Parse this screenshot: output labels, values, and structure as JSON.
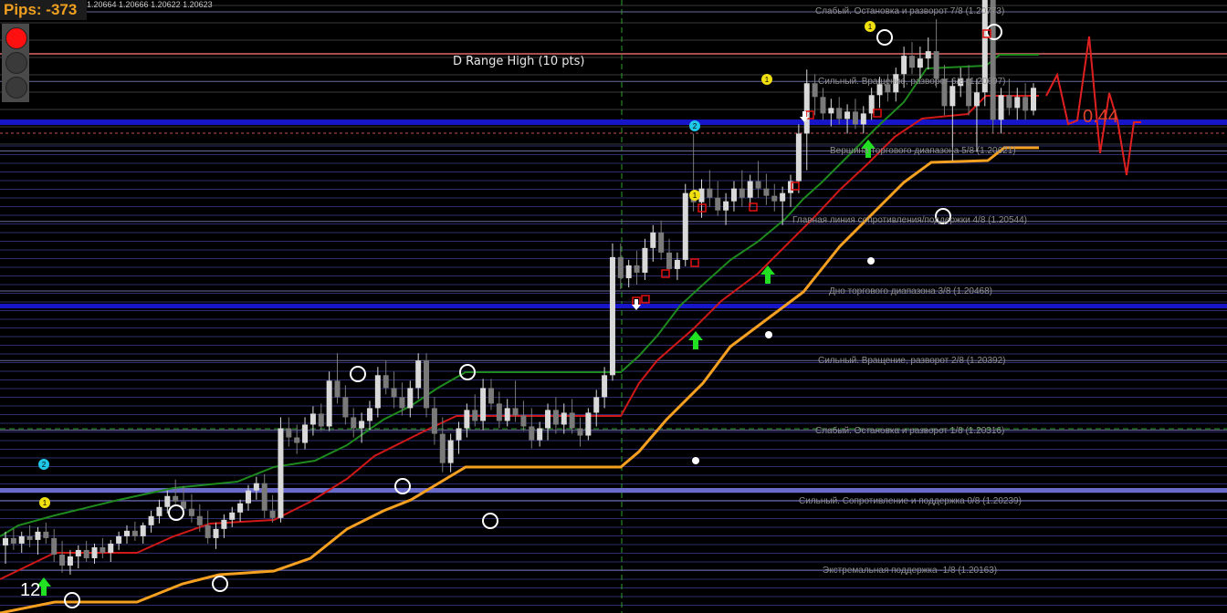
{
  "header": {
    "pips_text": "Pips:  -373",
    "ohlc_text": "1.20664 1.20666 1.20622 1.20623"
  },
  "traffic_light": {
    "active": "red",
    "colors": [
      "red",
      "off",
      "off"
    ]
  },
  "overlay": {
    "d_range_label": "D Range High (10 pts)",
    "ratio_value": "0.44",
    "bar_count": "12"
  },
  "levels": [
    {
      "label": "Слабый. Остановка и разворот 7/8  (1.20773)",
      "price": 1.20773
    },
    {
      "label": "Сильный. Вращение, разворот 6/8  (1.20697)",
      "price": 1.20697
    },
    {
      "label": "Вершина торгового диапазона 5/8  (1.20621)",
      "price": 1.20621
    },
    {
      "label": "Главная линия сопротивления/поддержки 4/8  (1.20544)",
      "price": 1.20544
    },
    {
      "label": "Дно торгового диапазона 3/8  (1.20468)",
      "price": 1.20468
    },
    {
      "label": "Сильный. Вращение, разворот 2/8  (1.20392)",
      "price": 1.20392
    },
    {
      "label": "Слабый. Остановка и разворот 1/8  (1.20316)",
      "price": 1.20316
    },
    {
      "label": "Сильный. Сопротивление и поддержка 0/8  (1.20239)",
      "price": 1.20239
    },
    {
      "label": "Экстремальная поддержка -1/8  (1.20163)",
      "price": 1.20163
    }
  ],
  "markers": {
    "yellow": "1",
    "cyan": "2"
  },
  "colors": {
    "background": "#000000",
    "candle_bull": "#d9d9d9",
    "candle_bear": "#7a7a7a",
    "line_green": "#1e8a1e",
    "line_red": "#d01818",
    "line_orange": "#f5a020",
    "level_blue": "#1616c8",
    "level_violet": "#6a6ac8",
    "arrow_green": "#22e022",
    "box_red": "#e01010",
    "d_range_line": "#e06868"
  },
  "chart_data": {
    "type": "candlestick",
    "title": "",
    "y_range": [
      1.2015,
      1.2085
    ],
    "levels": [
      1.20773,
      1.20697,
      1.20621,
      1.20544,
      1.20468,
      1.20392,
      1.20316,
      1.20239,
      1.20163
    ],
    "candles": [
      {
        "o": 1.2019,
        "h": 1.20205,
        "l": 1.2017,
        "c": 1.20198
      },
      {
        "o": 1.20198,
        "h": 1.20208,
        "l": 1.20185,
        "c": 1.20192
      },
      {
        "o": 1.20192,
        "h": 1.20205,
        "l": 1.20182,
        "c": 1.202
      },
      {
        "o": 1.202,
        "h": 1.20212,
        "l": 1.20188,
        "c": 1.20196
      },
      {
        "o": 1.20196,
        "h": 1.2021,
        "l": 1.2018,
        "c": 1.20205
      },
      {
        "o": 1.20205,
        "h": 1.20215,
        "l": 1.20192,
        "c": 1.20198
      },
      {
        "o": 1.20198,
        "h": 1.20208,
        "l": 1.20172,
        "c": 1.2018
      },
      {
        "o": 1.2018,
        "h": 1.20195,
        "l": 1.2016,
        "c": 1.20168
      },
      {
        "o": 1.20168,
        "h": 1.20185,
        "l": 1.20158,
        "c": 1.20178
      },
      {
        "o": 1.20178,
        "h": 1.2019,
        "l": 1.20165,
        "c": 1.20185
      },
      {
        "o": 1.20185,
        "h": 1.20195,
        "l": 1.20172,
        "c": 1.20176
      },
      {
        "o": 1.20176,
        "h": 1.20192,
        "l": 1.2017,
        "c": 1.20188
      },
      {
        "o": 1.20188,
        "h": 1.20198,
        "l": 1.20176,
        "c": 1.20182
      },
      {
        "o": 1.20182,
        "h": 1.20196,
        "l": 1.20172,
        "c": 1.20192
      },
      {
        "o": 1.20192,
        "h": 1.20205,
        "l": 1.20185,
        "c": 1.202
      },
      {
        "o": 1.202,
        "h": 1.20212,
        "l": 1.20192,
        "c": 1.20206
      },
      {
        "o": 1.20206,
        "h": 1.20216,
        "l": 1.20195,
        "c": 1.202
      },
      {
        "o": 1.202,
        "h": 1.20215,
        "l": 1.20192,
        "c": 1.20212
      },
      {
        "o": 1.20212,
        "h": 1.20228,
        "l": 1.20204,
        "c": 1.20222
      },
      {
        "o": 1.20222,
        "h": 1.2024,
        "l": 1.20214,
        "c": 1.20232
      },
      {
        "o": 1.20232,
        "h": 1.2025,
        "l": 1.20225,
        "c": 1.20244
      },
      {
        "o": 1.20244,
        "h": 1.20262,
        "l": 1.20235,
        "c": 1.20238
      },
      {
        "o": 1.20238,
        "h": 1.20255,
        "l": 1.20225,
        "c": 1.2023
      },
      {
        "o": 1.2023,
        "h": 1.20246,
        "l": 1.20215,
        "c": 1.20222
      },
      {
        "o": 1.20222,
        "h": 1.20235,
        "l": 1.20205,
        "c": 1.20212
      },
      {
        "o": 1.20212,
        "h": 1.20228,
        "l": 1.20192,
        "c": 1.20198
      },
      {
        "o": 1.20198,
        "h": 1.20215,
        "l": 1.20186,
        "c": 1.20208
      },
      {
        "o": 1.20208,
        "h": 1.20224,
        "l": 1.20198,
        "c": 1.20218
      },
      {
        "o": 1.20218,
        "h": 1.20232,
        "l": 1.2021,
        "c": 1.20226
      },
      {
        "o": 1.20226,
        "h": 1.2024,
        "l": 1.20216,
        "c": 1.20236
      },
      {
        "o": 1.20236,
        "h": 1.20256,
        "l": 1.20228,
        "c": 1.2025
      },
      {
        "o": 1.2025,
        "h": 1.20265,
        "l": 1.2024,
        "c": 1.20258
      },
      {
        "o": 1.20258,
        "h": 1.20268,
        "l": 1.2022,
        "c": 1.20228
      },
      {
        "o": 1.20228,
        "h": 1.20245,
        "l": 1.20215,
        "c": 1.2022
      },
      {
        "o": 1.2022,
        "h": 1.2033,
        "l": 1.20215,
        "c": 1.20318
      },
      {
        "o": 1.20318,
        "h": 1.2033,
        "l": 1.20298,
        "c": 1.20308
      },
      {
        "o": 1.20308,
        "h": 1.20322,
        "l": 1.2029,
        "c": 1.20302
      },
      {
        "o": 1.20302,
        "h": 1.2033,
        "l": 1.20295,
        "c": 1.20322
      },
      {
        "o": 1.20322,
        "h": 1.20342,
        "l": 1.2031,
        "c": 1.20334
      },
      {
        "o": 1.20334,
        "h": 1.20345,
        "l": 1.20315,
        "c": 1.2032
      },
      {
        "o": 1.2032,
        "h": 1.2038,
        "l": 1.20315,
        "c": 1.2037
      },
      {
        "o": 1.2037,
        "h": 1.204,
        "l": 1.20345,
        "c": 1.20352
      },
      {
        "o": 1.20352,
        "h": 1.20365,
        "l": 1.20322,
        "c": 1.2033
      },
      {
        "o": 1.2033,
        "h": 1.2034,
        "l": 1.20308,
        "c": 1.20318
      },
      {
        "o": 1.20318,
        "h": 1.20335,
        "l": 1.20302,
        "c": 1.20326
      },
      {
        "o": 1.20326,
        "h": 1.20348,
        "l": 1.20316,
        "c": 1.2034
      },
      {
        "o": 1.2034,
        "h": 1.20385,
        "l": 1.2033,
        "c": 1.20376
      },
      {
        "o": 1.20376,
        "h": 1.20392,
        "l": 1.20355,
        "c": 1.20362
      },
      {
        "o": 1.20362,
        "h": 1.2038,
        "l": 1.2034,
        "c": 1.20352
      },
      {
        "o": 1.20352,
        "h": 1.20368,
        "l": 1.20332,
        "c": 1.2034
      },
      {
        "o": 1.2034,
        "h": 1.2037,
        "l": 1.2033,
        "c": 1.20362
      },
      {
        "o": 1.20362,
        "h": 1.204,
        "l": 1.2035,
        "c": 1.20392
      },
      {
        "o": 1.20392,
        "h": 1.204,
        "l": 1.2033,
        "c": 1.2034
      },
      {
        "o": 1.2034,
        "h": 1.20352,
        "l": 1.203,
        "c": 1.20312
      },
      {
        "o": 1.20312,
        "h": 1.2033,
        "l": 1.2027,
        "c": 1.2028
      },
      {
        "o": 1.2028,
        "h": 1.20312,
        "l": 1.2027,
        "c": 1.20305
      },
      {
        "o": 1.20305,
        "h": 1.20325,
        "l": 1.2029,
        "c": 1.20318
      },
      {
        "o": 1.20318,
        "h": 1.20345,
        "l": 1.20308,
        "c": 1.20338
      },
      {
        "o": 1.20338,
        "h": 1.20355,
        "l": 1.2032,
        "c": 1.20326
      },
      {
        "o": 1.20326,
        "h": 1.20372,
        "l": 1.20316,
        "c": 1.20362
      },
      {
        "o": 1.20362,
        "h": 1.20372,
        "l": 1.20338,
        "c": 1.20345
      },
      {
        "o": 1.20345,
        "h": 1.20358,
        "l": 1.20318,
        "c": 1.20326
      },
      {
        "o": 1.20326,
        "h": 1.2035,
        "l": 1.2032,
        "c": 1.2034
      },
      {
        "o": 1.2034,
        "h": 1.2037,
        "l": 1.20325,
        "c": 1.20332
      },
      {
        "o": 1.20332,
        "h": 1.20348,
        "l": 1.20315,
        "c": 1.2032
      },
      {
        "o": 1.2032,
        "h": 1.2034,
        "l": 1.20296,
        "c": 1.20305
      },
      {
        "o": 1.20305,
        "h": 1.20325,
        "l": 1.20298,
        "c": 1.20318
      },
      {
        "o": 1.20318,
        "h": 1.20345,
        "l": 1.20305,
        "c": 1.20338
      },
      {
        "o": 1.20338,
        "h": 1.20352,
        "l": 1.20312,
        "c": 1.20322
      },
      {
        "o": 1.20322,
        "h": 1.20345,
        "l": 1.20312,
        "c": 1.20335
      },
      {
        "o": 1.20335,
        "h": 1.2035,
        "l": 1.20312,
        "c": 1.20318
      },
      {
        "o": 1.20318,
        "h": 1.2033,
        "l": 1.20298,
        "c": 1.2031
      },
      {
        "o": 1.2031,
        "h": 1.2034,
        "l": 1.20305,
        "c": 1.20335
      },
      {
        "o": 1.20335,
        "h": 1.2036,
        "l": 1.2032,
        "c": 1.20352
      },
      {
        "o": 1.20352,
        "h": 1.20385,
        "l": 1.2034,
        "c": 1.20376
      },
      {
        "o": 1.20376,
        "h": 1.2052,
        "l": 1.2037,
        "c": 1.20505
      },
      {
        "o": 1.20505,
        "h": 1.2052,
        "l": 1.2047,
        "c": 1.20482
      },
      {
        "o": 1.20482,
        "h": 1.20502,
        "l": 1.20472,
        "c": 1.20496
      },
      {
        "o": 1.20496,
        "h": 1.20512,
        "l": 1.20475,
        "c": 1.20488
      },
      {
        "o": 1.20488,
        "h": 1.20525,
        "l": 1.2048,
        "c": 1.20515
      },
      {
        "o": 1.20515,
        "h": 1.2054,
        "l": 1.205,
        "c": 1.20532
      },
      {
        "o": 1.20532,
        "h": 1.20545,
        "l": 1.20502,
        "c": 1.2051
      },
      {
        "o": 1.2051,
        "h": 1.20525,
        "l": 1.20485,
        "c": 1.20492
      },
      {
        "o": 1.20492,
        "h": 1.2051,
        "l": 1.2048,
        "c": 1.20502
      },
      {
        "o": 1.20502,
        "h": 1.20585,
        "l": 1.20495,
        "c": 1.20575
      },
      {
        "o": 1.20575,
        "h": 1.2064,
        "l": 1.20555,
        "c": 1.20565
      },
      {
        "o": 1.20565,
        "h": 1.2059,
        "l": 1.20548,
        "c": 1.2058
      },
      {
        "o": 1.2058,
        "h": 1.206,
        "l": 1.2056,
        "c": 1.2057
      },
      {
        "o": 1.2057,
        "h": 1.20588,
        "l": 1.2055,
        "c": 1.20556
      },
      {
        "o": 1.20556,
        "h": 1.20575,
        "l": 1.2054,
        "c": 1.20566
      },
      {
        "o": 1.20566,
        "h": 1.20588,
        "l": 1.20555,
        "c": 1.2058
      },
      {
        "o": 1.2058,
        "h": 1.206,
        "l": 1.2056,
        "c": 1.2057
      },
      {
        "o": 1.2057,
        "h": 1.20595,
        "l": 1.2056,
        "c": 1.20588
      },
      {
        "o": 1.20588,
        "h": 1.2061,
        "l": 1.2057,
        "c": 1.2058
      },
      {
        "o": 1.2058,
        "h": 1.20596,
        "l": 1.20562,
        "c": 1.20572
      },
      {
        "o": 1.20572,
        "h": 1.20585,
        "l": 1.20555,
        "c": 1.20566
      },
      {
        "o": 1.20566,
        "h": 1.20582,
        "l": 1.2054,
        "c": 1.20575
      },
      {
        "o": 1.20575,
        "h": 1.20595,
        "l": 1.2056,
        "c": 1.20588
      },
      {
        "o": 1.20588,
        "h": 1.2065,
        "l": 1.20575,
        "c": 1.2064
      },
      {
        "o": 1.2064,
        "h": 1.2071,
        "l": 1.206,
        "c": 1.20695
      },
      {
        "o": 1.20695,
        "h": 1.20705,
        "l": 1.2066,
        "c": 1.2068
      },
      {
        "o": 1.2068,
        "h": 1.2069,
        "l": 1.20655,
        "c": 1.20662
      },
      {
        "o": 1.20662,
        "h": 1.20678,
        "l": 1.20648,
        "c": 1.20668
      },
      {
        "o": 1.20668,
        "h": 1.2068,
        "l": 1.2065,
        "c": 1.20656
      },
      {
        "o": 1.20656,
        "h": 1.20672,
        "l": 1.2064,
        "c": 1.20664
      },
      {
        "o": 1.20664,
        "h": 1.20678,
        "l": 1.20645,
        "c": 1.2065
      },
      {
        "o": 1.2065,
        "h": 1.2067,
        "l": 1.2064,
        "c": 1.20662
      },
      {
        "o": 1.20662,
        "h": 1.2069,
        "l": 1.20655,
        "c": 1.20682
      },
      {
        "o": 1.20682,
        "h": 1.20702,
        "l": 1.20668,
        "c": 1.20694
      },
      {
        "o": 1.20694,
        "h": 1.20705,
        "l": 1.20675,
        "c": 1.20685
      },
      {
        "o": 1.20685,
        "h": 1.20712,
        "l": 1.20675,
        "c": 1.20705
      },
      {
        "o": 1.20705,
        "h": 1.20735,
        "l": 1.2069,
        "c": 1.20725
      },
      {
        "o": 1.20725,
        "h": 1.2074,
        "l": 1.20705,
        "c": 1.20712
      },
      {
        "o": 1.20712,
        "h": 1.20735,
        "l": 1.207,
        "c": 1.20722
      },
      {
        "o": 1.20722,
        "h": 1.20745,
        "l": 1.2071,
        "c": 1.2073
      },
      {
        "o": 1.2073,
        "h": 1.20765,
        "l": 1.2069,
        "c": 1.207
      },
      {
        "o": 1.207,
        "h": 1.20715,
        "l": 1.2066,
        "c": 1.2067
      },
      {
        "o": 1.2067,
        "h": 1.207,
        "l": 1.2061,
        "c": 1.20692
      },
      {
        "o": 1.20692,
        "h": 1.20712,
        "l": 1.2068,
        "c": 1.207
      },
      {
        "o": 1.207,
        "h": 1.20715,
        "l": 1.2066,
        "c": 1.2067
      },
      {
        "o": 1.2067,
        "h": 1.207,
        "l": 1.2062,
        "c": 1.20685
      },
      {
        "o": 1.20685,
        "h": 1.2081,
        "l": 1.2067,
        "c": 1.20795
      },
      {
        "o": 1.20795,
        "h": 1.20815,
        "l": 1.2064,
        "c": 1.20655
      },
      {
        "o": 1.20655,
        "h": 1.2069,
        "l": 1.2064,
        "c": 1.20682
      },
      {
        "o": 1.20682,
        "h": 1.207,
        "l": 1.2066,
        "c": 1.20668
      },
      {
        "o": 1.20668,
        "h": 1.2069,
        "l": 1.20655,
        "c": 1.2068
      },
      {
        "o": 1.2068,
        "h": 1.20695,
        "l": 1.20655,
        "c": 1.20665
      },
      {
        "o": 1.20665,
        "h": 1.20695,
        "l": 1.2066,
        "c": 1.2069
      }
    ]
  }
}
